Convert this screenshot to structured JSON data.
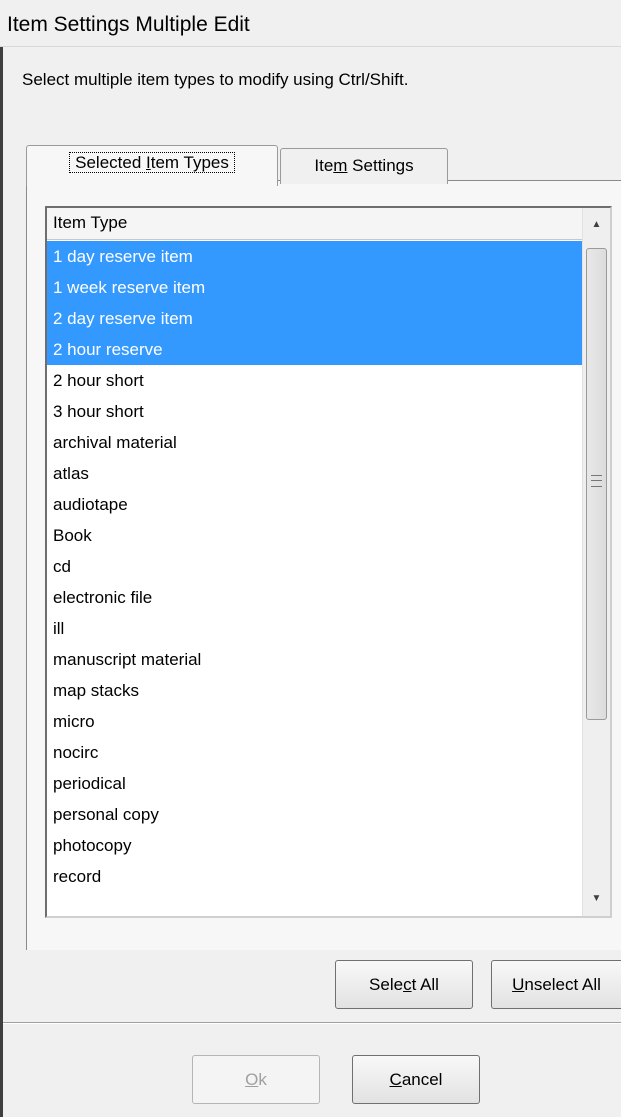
{
  "window": {
    "title": "Item Settings Multiple Edit"
  },
  "instruction": "Select multiple item types to modify using Ctrl/Shift.",
  "tabs": [
    {
      "pre": "Selected ",
      "accel": "I",
      "post": "tem Types",
      "active": true
    },
    {
      "pre": "Ite",
      "accel": "m",
      "post": " Settings",
      "active": false
    }
  ],
  "list": {
    "column_header": "Item Type",
    "items": [
      {
        "label": "1 day reserve item",
        "selected": true
      },
      {
        "label": "1 week reserve item",
        "selected": true
      },
      {
        "label": "2 day reserve item",
        "selected": true
      },
      {
        "label": "2 hour reserve",
        "selected": true
      },
      {
        "label": "2 hour short",
        "selected": false
      },
      {
        "label": "3 hour short",
        "selected": false
      },
      {
        "label": "archival material",
        "selected": false
      },
      {
        "label": "atlas",
        "selected": false
      },
      {
        "label": "audiotape",
        "selected": false
      },
      {
        "label": "Book",
        "selected": false
      },
      {
        "label": "cd",
        "selected": false
      },
      {
        "label": "electronic file",
        "selected": false
      },
      {
        "label": "ill",
        "selected": false
      },
      {
        "label": "manuscript material",
        "selected": false
      },
      {
        "label": "map stacks",
        "selected": false
      },
      {
        "label": "micro",
        "selected": false
      },
      {
        "label": "nocirc",
        "selected": false
      },
      {
        "label": "periodical",
        "selected": false
      },
      {
        "label": "personal copy",
        "selected": false
      },
      {
        "label": "photocopy",
        "selected": false
      },
      {
        "label": "record",
        "selected": false
      }
    ]
  },
  "buttons": {
    "select_all": {
      "pre": "Sele",
      "accel": "c",
      "post": "t All"
    },
    "unselect_all": {
      "pre": "",
      "accel": "U",
      "post": "nselect All"
    },
    "ok": {
      "pre": "",
      "accel": "O",
      "post": "k",
      "enabled": false
    },
    "cancel": {
      "pre": "",
      "accel": "C",
      "post": "ancel"
    }
  },
  "colors": {
    "selection": "#3399ff",
    "dialog_bg": "#f0f0f0"
  }
}
